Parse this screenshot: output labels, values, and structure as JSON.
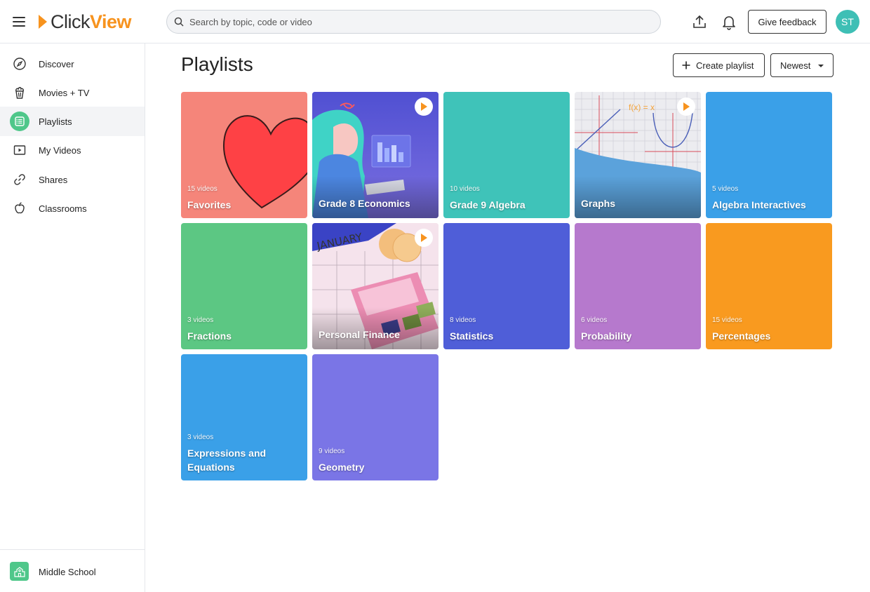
{
  "header": {
    "logo": {
      "click": "Click",
      "view": "View"
    },
    "search_placeholder": "Search by topic, code or video",
    "feedback_label": "Give feedback",
    "avatar_initials": "ST",
    "avatar_color": "#3ebfb5"
  },
  "sidebar": {
    "items": [
      {
        "label": "Discover",
        "icon": "compass-icon",
        "active": false
      },
      {
        "label": "Movies + TV",
        "icon": "popcorn-icon",
        "active": false
      },
      {
        "label": "Playlists",
        "icon": "list-icon",
        "active": true
      },
      {
        "label": "My Videos",
        "icon": "play-square-icon",
        "active": false
      },
      {
        "label": "Shares",
        "icon": "link-icon",
        "active": false
      },
      {
        "label": "Classrooms",
        "icon": "apple-icon",
        "active": false
      }
    ],
    "footer_label": "Middle School",
    "accent": "#4fc78a"
  },
  "main": {
    "title": "Playlists",
    "create_label": "Create playlist",
    "sort_label": "Newest"
  },
  "playlists": [
    {
      "title": "Favorites",
      "count": "15 videos",
      "color": "#f5857a"
    },
    {
      "title": "Grade 8 Economics",
      "count": "",
      "color": "#5b5bd6"
    },
    {
      "title": "Grade 9 Algebra",
      "count": "10 videos",
      "color": "#3fc3b9"
    },
    {
      "title": "Graphs",
      "count": "",
      "color": "#e9e9ee"
    },
    {
      "title": "Algebra Interactives",
      "count": "5 videos",
      "color": "#3aa0e8"
    },
    {
      "title": "Fractions",
      "count": "3 videos",
      "color": "#5cc783"
    },
    {
      "title": "Personal Finance",
      "count": "",
      "color": "#f4dce6"
    },
    {
      "title": "Statistics",
      "count": "8 videos",
      "color": "#4f5ed8"
    },
    {
      "title": "Probability",
      "count": "6 videos",
      "color": "#b679cd"
    },
    {
      "title": "Percentages",
      "count": "15 videos",
      "color": "#f99a1f"
    },
    {
      "title": "Expressions and Equations",
      "count": "3 videos",
      "color": "#3aa0e8"
    },
    {
      "title": "Geometry",
      "count": "9 videos",
      "color": "#7a75e6"
    }
  ],
  "art_text": {
    "graphs_formula": "f(x) = x",
    "finance_month": "JANUARY"
  }
}
